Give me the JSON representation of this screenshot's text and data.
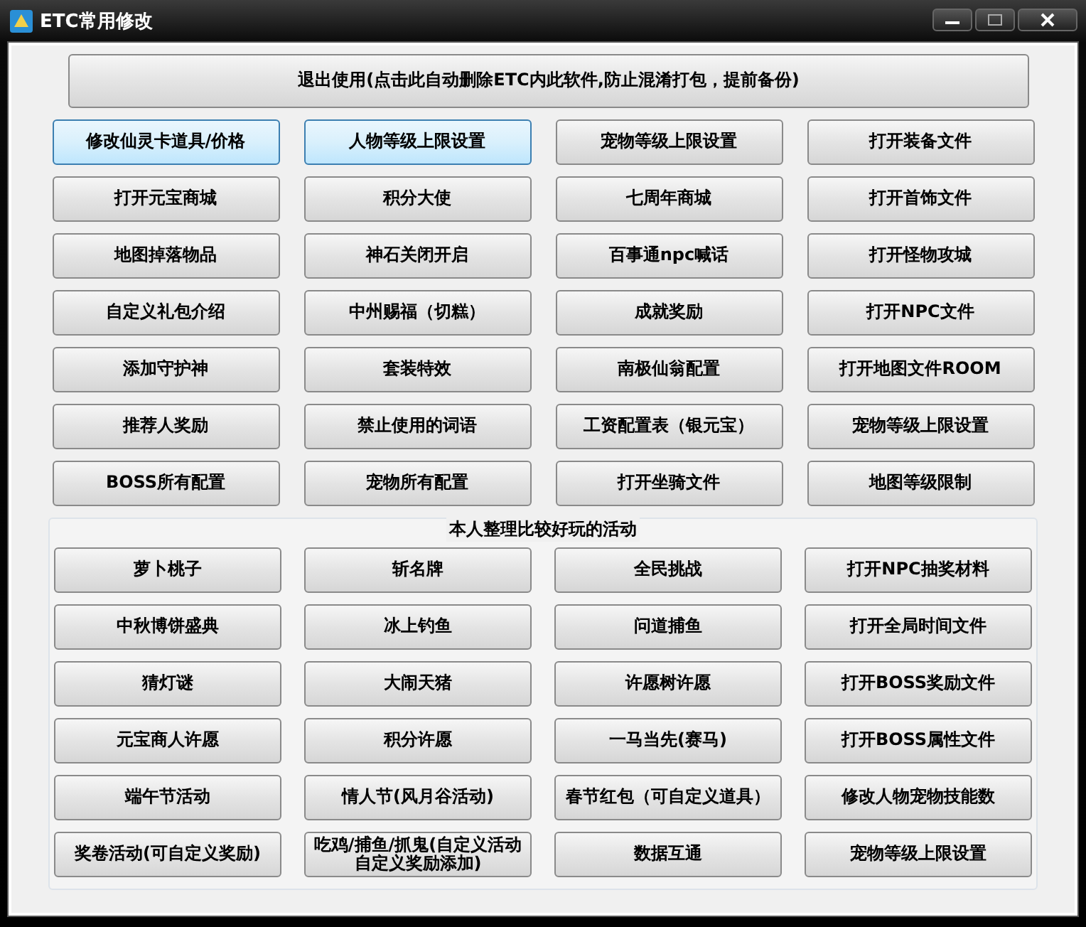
{
  "window": {
    "title": "ETC常用修改"
  },
  "exit_button": {
    "label": "退出使用(点击此自动删除ETC内此软件,防止混淆打包，提前备份)"
  },
  "buttons": [
    {
      "label": "修改仙灵卡道具/价格",
      "selected": true
    },
    {
      "label": "人物等级上限设置",
      "selected": true
    },
    {
      "label": "宠物等级上限设置",
      "selected": false
    },
    {
      "label": "打开装备文件",
      "selected": false
    },
    {
      "label": "打开元宝商城",
      "selected": false
    },
    {
      "label": "积分大使",
      "selected": false
    },
    {
      "label": "七周年商城",
      "selected": false
    },
    {
      "label": "打开首饰文件",
      "selected": false
    },
    {
      "label": "地图掉落物品",
      "selected": false
    },
    {
      "label": "神石关闭开启",
      "selected": false
    },
    {
      "label": "百事通npc喊话",
      "selected": false
    },
    {
      "label": "打开怪物攻城",
      "selected": false
    },
    {
      "label": "自定义礼包介绍",
      "selected": false
    },
    {
      "label": "中州赐福（切糕）",
      "selected": false
    },
    {
      "label": "成就奖励",
      "selected": false
    },
    {
      "label": "打开NPC文件",
      "selected": false
    },
    {
      "label": "添加守护神",
      "selected": false
    },
    {
      "label": "套装特效",
      "selected": false
    },
    {
      "label": "南极仙翁配置",
      "selected": false
    },
    {
      "label": "打开地图文件ROOM",
      "selected": false
    },
    {
      "label": "推荐人奖励",
      "selected": false
    },
    {
      "label": "禁止使用的词语",
      "selected": false
    },
    {
      "label": "工资配置表（银元宝）",
      "selected": false
    },
    {
      "label": "宠物等级上限设置",
      "selected": false
    },
    {
      "label": "BOSS所有配置",
      "selected": false
    },
    {
      "label": "宠物所有配置",
      "selected": false
    },
    {
      "label": "打开坐骑文件",
      "selected": false
    },
    {
      "label": "地图等级限制",
      "selected": false
    }
  ],
  "activities": {
    "title": "本人整理比较好玩的活动",
    "buttons": [
      {
        "label": "萝卜桃子",
        "selected": false
      },
      {
        "label": "斩名牌",
        "selected": false
      },
      {
        "label": "全民挑战",
        "selected": false
      },
      {
        "label": "打开NPC抽奖材料",
        "selected": false
      },
      {
        "label": "中秋博饼盛典",
        "selected": false
      },
      {
        "label": "冰上钓鱼",
        "selected": false
      },
      {
        "label": "问道捕鱼",
        "selected": false
      },
      {
        "label": "打开全局时间文件",
        "selected": false
      },
      {
        "label": "猜灯谜",
        "selected": false
      },
      {
        "label": "大闹天猪",
        "selected": false
      },
      {
        "label": "许愿树许愿",
        "selected": false
      },
      {
        "label": "打开BOSS奖励文件",
        "selected": false
      },
      {
        "label": "元宝商人许愿",
        "selected": false
      },
      {
        "label": "积分许愿",
        "selected": false
      },
      {
        "label": "一马当先(赛马)",
        "selected": false
      },
      {
        "label": "打开BOSS属性文件",
        "selected": false
      },
      {
        "label": "端午节活动",
        "selected": false
      },
      {
        "label": "情人节(风月谷活动)",
        "selected": false
      },
      {
        "label": "春节红包（可自定义道具）",
        "selected": false
      },
      {
        "label": "修改人物宠物技能数",
        "selected": false
      },
      {
        "label": "奖卷活动(可自定义奖励)",
        "selected": false
      },
      {
        "label": "吃鸡/捕鱼/抓鬼(自定义活动自定义奖励添加)",
        "selected": false
      },
      {
        "label": "数据互通",
        "selected": false
      },
      {
        "label": "宠物等级上限设置",
        "selected": false
      }
    ]
  }
}
